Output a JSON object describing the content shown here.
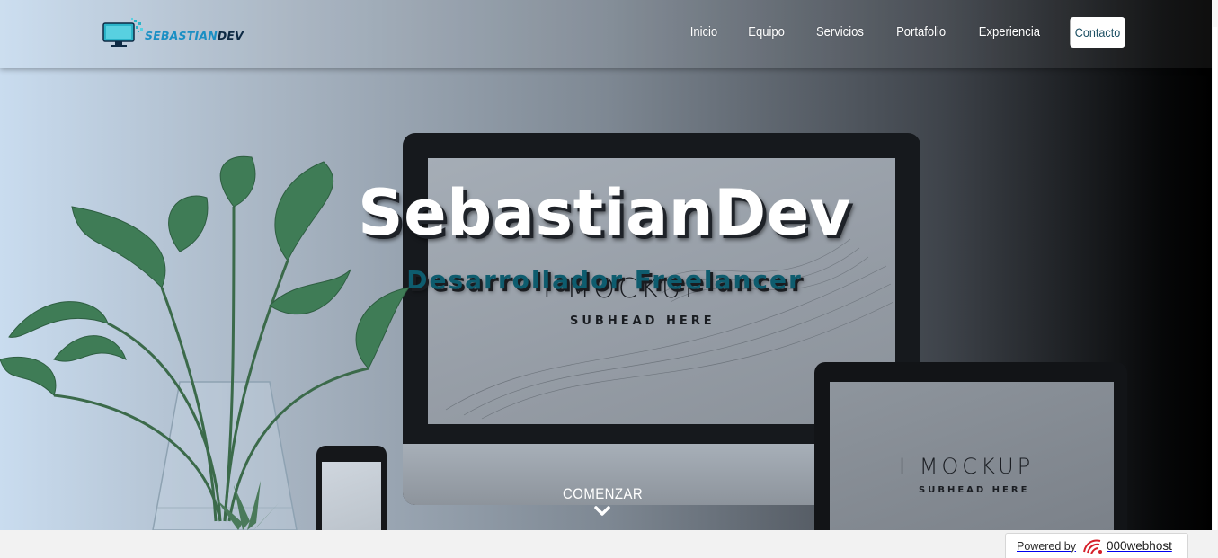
{
  "brand": {
    "logo_text_main": "SEBASTIAN",
    "logo_text_accent": "DEV",
    "logo_color": "#2bb3c8"
  },
  "nav": {
    "items": [
      {
        "label": "Inicio"
      },
      {
        "label": "Equipo"
      },
      {
        "label": "Servicios"
      },
      {
        "label": "Portafolio"
      },
      {
        "label": "Experiencia"
      },
      {
        "label": "Contacto",
        "active": true
      }
    ]
  },
  "hero": {
    "title": "SebastianDev",
    "subtitle": "Desarrollador Freelancer",
    "cta_label": "COMENZAR",
    "cta_icon": "chevron-down-icon",
    "mockup_title": "I MOCKUP",
    "mockup_subhead": "SUBHEAD HERE",
    "tablet_mockup_title": "I MOCKUP",
    "tablet_mockup_subhead": "SUBHEAD HERE",
    "subtitle_color": "#0e5c6e"
  },
  "footer_badge": {
    "powered_label": "Powered by",
    "brand_label": "000webhost",
    "brand_color": "#d6202a"
  }
}
